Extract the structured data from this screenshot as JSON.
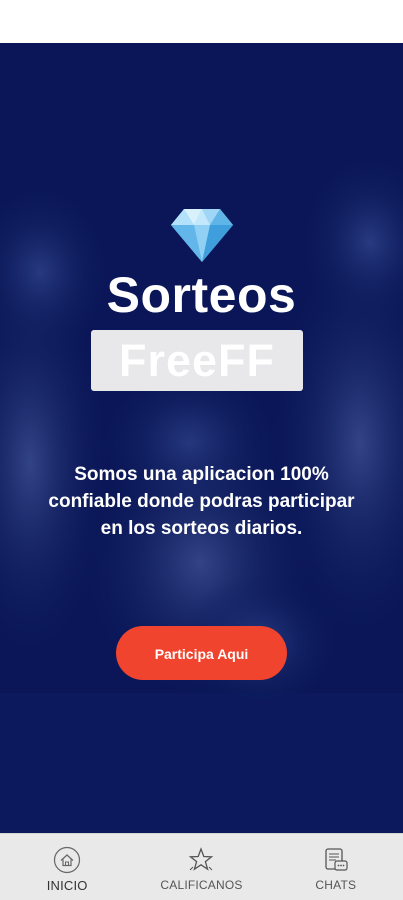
{
  "hero": {
    "title": "Sorteos",
    "subtitle": "FreeFF",
    "description": "Somos una aplicacion 100% confiable donde podras participar en los sorteos diarios.",
    "cta_label": "Participa Aqui",
    "icon": "diamond-icon"
  },
  "bottom_nav": {
    "items": [
      {
        "label": "INICIO",
        "icon": "home-icon",
        "active": true
      },
      {
        "label": "CALIFICANOS",
        "icon": "star-icon",
        "active": false
      },
      {
        "label": "CHATS",
        "icon": "chat-icon",
        "active": false
      }
    ]
  },
  "colors": {
    "hero_overlay": "#0b1a5c",
    "cta": "#f0442e",
    "nav_background": "#e9e9e9",
    "subtitle_box": "#e8e8ea"
  }
}
